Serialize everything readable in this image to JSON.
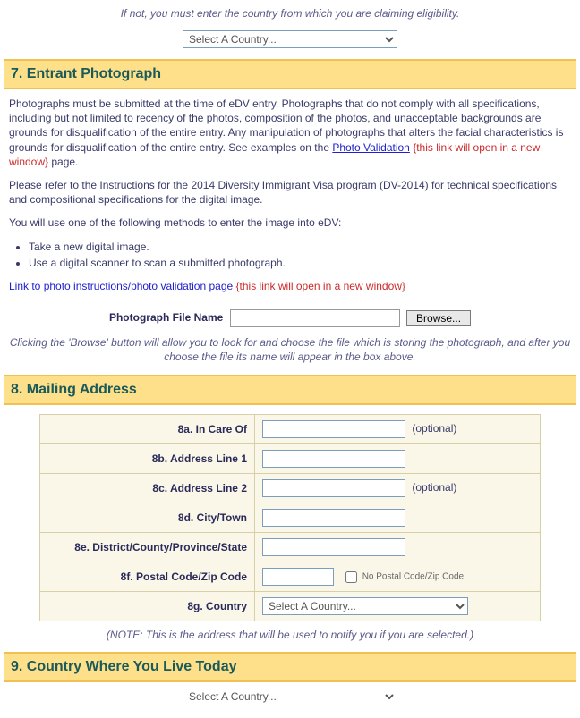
{
  "top_note": "If not, you must enter the country from which you are claiming eligibility.",
  "top_select_option": "Select A Country...",
  "section7_title": "7. Entrant Photograph",
  "s7_p1_a": "Photographs must be submitted at the time of eDV entry. Photographs that do not comply with all specifications, including but not limited to recency of the photos, composition of the photos, and unacceptable backgrounds are grounds for disqualification of the entire entry. Any manipulation of photographs that alters the facial characteristics is grounds for disqualification of the entire entry. See examples on the ",
  "s7_link1": "Photo Validation",
  "s7_link_note": "{this link will open in a new window}",
  "s7_p1_b": " page.",
  "s7_p2": "Please refer to the Instructions for the 2014 Diversity Immigrant Visa program (DV-2014) for technical specifications and compositional specifications for the digital image.",
  "s7_p3": "You will use one of the following methods to enter the image into eDV:",
  "s7_li1": "Take a new digital image.",
  "s7_li2": "Use a digital scanner to scan a submitted photograph.",
  "s7_link2": "Link to photo instructions/photo validation page",
  "photo_label": "Photograph File Name",
  "browse_label": "Browse...",
  "browse_hint": "Clicking the 'Browse' button will allow you to look for and choose the file which is storing the photograph, and after you choose the file its name will appear in the box above.",
  "section8_title": "8. Mailing Address",
  "addr": {
    "a": "8a. In Care Of",
    "b": "8b. Address Line 1",
    "c": "8c. Address Line 2",
    "d": "8d. City/Town",
    "e": "8e. District/County/Province/State",
    "f": "8f. Postal Code/Zip Code",
    "g": "8g. Country"
  },
  "optional": "(optional)",
  "no_zip": "No Postal Code/Zip Code",
  "country_option": "Select A Country...",
  "addr_note": "(NOTE: This is the address that will be used to notify you if you are selected.)",
  "section9_title": "9. Country Where You Live Today",
  "s9_select_option": "Select A Country..."
}
